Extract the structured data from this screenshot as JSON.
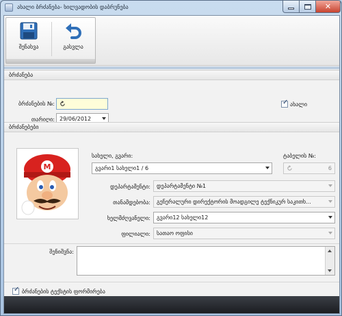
{
  "window": {
    "title": "ახალი ბრძანება- ხილვადობის დაბრუნება"
  },
  "ribbon": {
    "save_label": "შენახვა",
    "undo_label": "გასვლა"
  },
  "section_order": {
    "header": "ბრძანება",
    "order_number_label": "ბრძანების №:",
    "order_number_value": "",
    "date_label": "თარიღი:",
    "date_value": "29/06/2012",
    "new_checkbox_label": "ახალი",
    "new_checked": true
  },
  "section_orders": {
    "header": "ბრძანებები",
    "name_label": "სახელი, გვარი:",
    "name_value": "გვარი1 სახელი1 / 6",
    "table_number_label": "ტაბელის №:",
    "table_number_value": "6",
    "department_label": "დეპარტამენტი:",
    "department_value": "დეპარტამენტი №1",
    "position_label": "თანამდებობა:",
    "position_value": "გენერალური დირექტორის მოადგილე ტექნიკურ საკითხ...",
    "manager_label": "ხელმძღვანელი:",
    "manager_value": "გვარი12 სახელი12",
    "branch_label": "ფილიალი:",
    "branch_value": "სათაო ოფისი"
  },
  "notes": {
    "label": "შენიშვნა:",
    "value": ""
  },
  "footer": {
    "checkbox_label": "ბრძანების ტექსტის ფორმირება",
    "checked": true
  },
  "colors": {
    "highlight_field": "#fefdd9",
    "title_bar": "#b9cfe6",
    "close_button": "#c8432f"
  }
}
